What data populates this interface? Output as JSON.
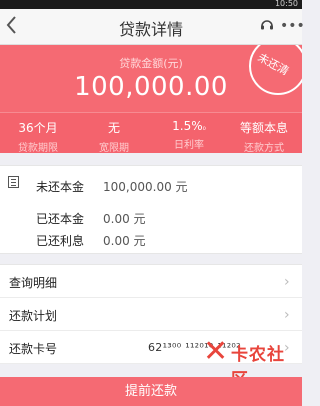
{
  "status_bar": {
    "time": "10:50"
  },
  "header": {
    "title": "贷款详情"
  },
  "hero": {
    "amount_label": "贷款金额(元)",
    "amount": "100,000.00",
    "stamp": "未还清",
    "stats": [
      {
        "value": "36个月",
        "label": "贷款期限"
      },
      {
        "value": "无",
        "label": "宽限期"
      },
      {
        "value": "1.5%",
        "unit": "₀",
        "label": "日利率"
      },
      {
        "value": "等额本息",
        "label": "还款方式"
      }
    ]
  },
  "summary": {
    "unpaid_principal_label": "未还本金",
    "unpaid_principal_value": "100,000.00 元",
    "paid_principal_label": "已还本金",
    "paid_principal_value": "0.00 元",
    "paid_interest_label": "已还利息",
    "paid_interest_value": "0.00 元"
  },
  "menu": {
    "query_detail": "查询明细",
    "repay_plan": "还款计划",
    "repay_card_label": "还款卡号",
    "repay_card_value": "62¹³⁰⁰ ¹¹²⁰¹⁰ ¹¹²⁰²"
  },
  "watermark": {
    "text": "卡农社区"
  },
  "footer": {
    "early_repay": "提前还款"
  },
  "colors": {
    "accent": "#f56a73",
    "watermark": "#e8453c"
  }
}
